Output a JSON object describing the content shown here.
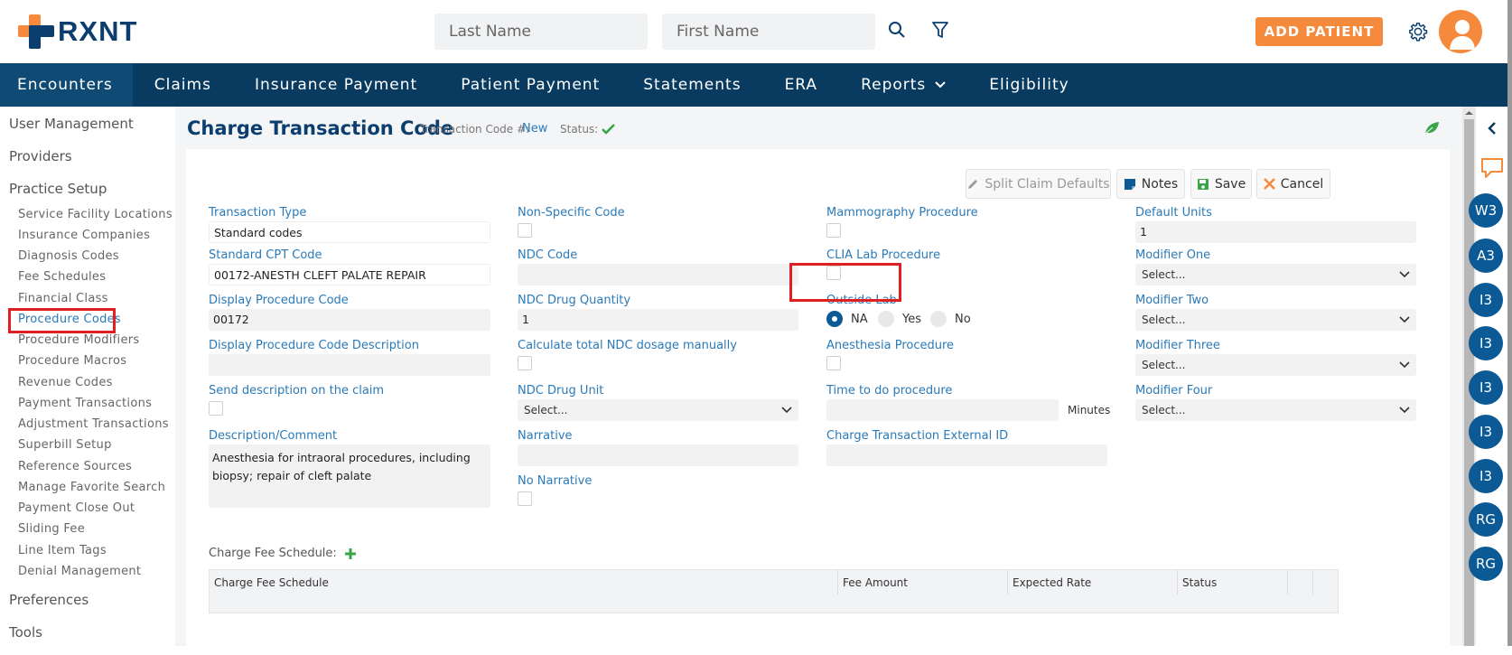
{
  "app": {
    "logo_text": "RXNT",
    "brand_color": "#0b3e6f",
    "accent_color": "#f58a3d"
  },
  "header": {
    "last_name_placeholder": "Last Name",
    "first_name_placeholder": "First Name",
    "add_patient_label": "ADD PATIENT"
  },
  "nav": {
    "items": [
      "Encounters",
      "Claims",
      "Insurance Payment",
      "Patient Payment",
      "Statements",
      "ERA",
      "Reports",
      "Eligibility"
    ]
  },
  "sidebar": {
    "sections": [
      "User Management",
      "Providers",
      "Practice Setup",
      "Preferences",
      "Tools"
    ],
    "practice_items": [
      "Service Facility Locations",
      "Insurance Companies",
      "Diagnosis Codes",
      "Fee Schedules",
      "Financial Class",
      "Procedure Codes",
      "Procedure Modifiers",
      "Procedure Macros",
      "Revenue Codes",
      "Payment Transactions",
      "Adjustment Transactions",
      "Superbill Setup",
      "Reference Sources",
      "Manage Favorite Search",
      "Payment Close Out",
      "Sliding Fee",
      "Line Item Tags",
      "Denial Management"
    ],
    "active_item": "Procedure Codes"
  },
  "page": {
    "title": "Charge Transaction Code",
    "transaction_code_label": "Transaction Code #:",
    "transaction_code_value": "New",
    "status_label": "Status:"
  },
  "toolbar": {
    "split_claim": "Split Claim Defaults",
    "notes": "Notes",
    "save": "Save",
    "cancel": "Cancel"
  },
  "form": {
    "transaction_type": {
      "label": "Transaction Type",
      "value": "Standard codes"
    },
    "standard_cpt": {
      "label": "Standard CPT Code",
      "value": "00172-ANESTH CLEFT PALATE REPAIR"
    },
    "display_code": {
      "label": "Display Procedure Code",
      "value": "00172"
    },
    "display_desc": {
      "label": "Display Procedure Code Description",
      "value": ""
    },
    "send_desc": {
      "label": "Send description on the claim"
    },
    "description": {
      "label": "Description/Comment",
      "value": "Anesthesia for intraoral procedures, including biopsy; repair of cleft palate"
    },
    "non_specific": {
      "label": "Non-Specific Code"
    },
    "ndc_code": {
      "label": "NDC Code",
      "value": ""
    },
    "ndc_qty": {
      "label": "NDC Drug Quantity",
      "value": "1"
    },
    "calc_ndc": {
      "label": "Calculate total NDC dosage manually"
    },
    "ndc_unit": {
      "label": "NDC Drug Unit",
      "value": "Select..."
    },
    "narrative": {
      "label": "Narrative",
      "value": ""
    },
    "no_narrative": {
      "label": "No Narrative"
    },
    "mammography": {
      "label": "Mammography Procedure"
    },
    "clia": {
      "label": "CLIA Lab Procedure"
    },
    "outside_lab": {
      "label": "Outside Lab",
      "options": [
        "NA",
        "Yes",
        "No"
      ],
      "selected": "NA"
    },
    "anesthesia": {
      "label": "Anesthesia Procedure"
    },
    "time_to_do": {
      "label": "Time to do procedure",
      "value": "",
      "unit": "Minutes"
    },
    "external_id": {
      "label": "Charge Transaction External ID",
      "value": ""
    },
    "default_units": {
      "label": "Default Units",
      "value": "1"
    },
    "modifier_one": {
      "label": "Modifier One",
      "value": "Select..."
    },
    "modifier_two": {
      "label": "Modifier Two",
      "value": "Select..."
    },
    "modifier_three": {
      "label": "Modifier Three",
      "value": "Select..."
    },
    "modifier_four": {
      "label": "Modifier Four",
      "value": "Select..."
    }
  },
  "fee_schedule": {
    "label": "Charge Fee Schedule:",
    "columns": [
      "Charge Fee Schedule",
      "Fee Amount",
      "Expected Rate",
      "Status"
    ]
  },
  "right_panel": {
    "badges": [
      "W3",
      "A3",
      "I3",
      "I3",
      "I3",
      "I3",
      "I3",
      "RG",
      "RG"
    ]
  }
}
